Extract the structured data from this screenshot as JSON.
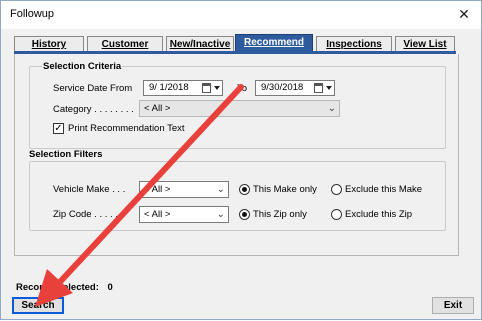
{
  "window": {
    "title": "Followup",
    "close_glyph": "✕"
  },
  "tabs": [
    {
      "label": "History"
    },
    {
      "label": "Customer"
    },
    {
      "label": "New/Inactive"
    },
    {
      "label": "Recommend"
    },
    {
      "label": "Inspections"
    },
    {
      "label": "View List"
    }
  ],
  "active_tab": "Recommend",
  "selection_criteria": {
    "title": "Selection Criteria",
    "service_date_label": "Service Date From",
    "date_from": "9/  1/2018",
    "to_label": "To",
    "date_to": "9/30/2018",
    "category_label": "Category . . . . . . . .",
    "category_value": "< All >",
    "print_recommendation_label": "Print Recommendation Text",
    "print_recommendation_checked": true
  },
  "selection_filters": {
    "title": "Selection Filters",
    "vehicle_make_label": "Vehicle Make . . .",
    "vehicle_make_value": "< All >",
    "make_options": [
      "This Make only",
      "Exclude this Make"
    ],
    "make_selected": "This Make only",
    "zip_label": "Zip Code . . . . . .",
    "zip_value": "< All >",
    "zip_options": [
      "This Zip only",
      "Exclude this Zip"
    ],
    "zip_selected": "This Zip only"
  },
  "status": {
    "records_selected_label": "Records Selected:",
    "records_selected_value": "0"
  },
  "buttons": {
    "search": "Search",
    "exit": "Exit"
  },
  "annotation": {
    "arrow_color": "#e8403a"
  },
  "icons": [
    "close-icon",
    "calendar-icon",
    "dropdown-arrow-icon",
    "chevron-down-icon",
    "checkbox-check-icon"
  ]
}
